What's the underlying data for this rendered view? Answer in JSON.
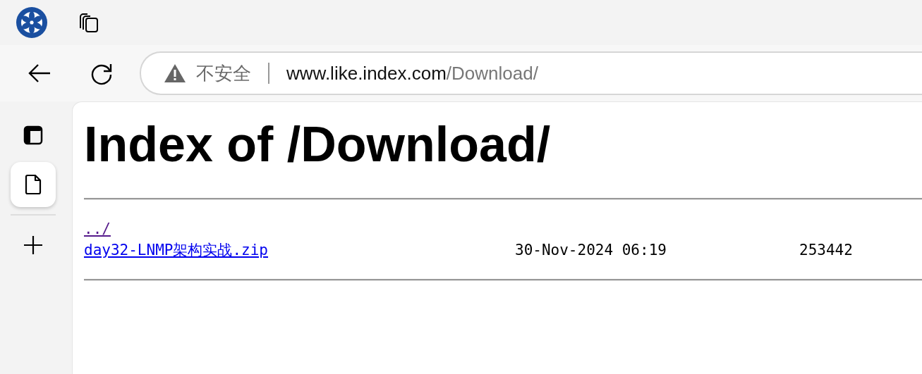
{
  "address_bar": {
    "security_label": "不安全",
    "host": "www.like.index.com",
    "path": "/Download/"
  },
  "sidebar": {
    "items": [
      {
        "kind": "tabs",
        "selected": false
      },
      {
        "kind": "page",
        "selected": true
      },
      {
        "kind": "add",
        "selected": false
      }
    ]
  },
  "page": {
    "heading": "Index of /Download/",
    "entries": [
      {
        "name": "../",
        "visited": true
      },
      {
        "name": "day32-LNMP架构实战.zip",
        "date": "30-Nov-2024 06:19",
        "size": "253442",
        "visited": false
      }
    ]
  }
}
